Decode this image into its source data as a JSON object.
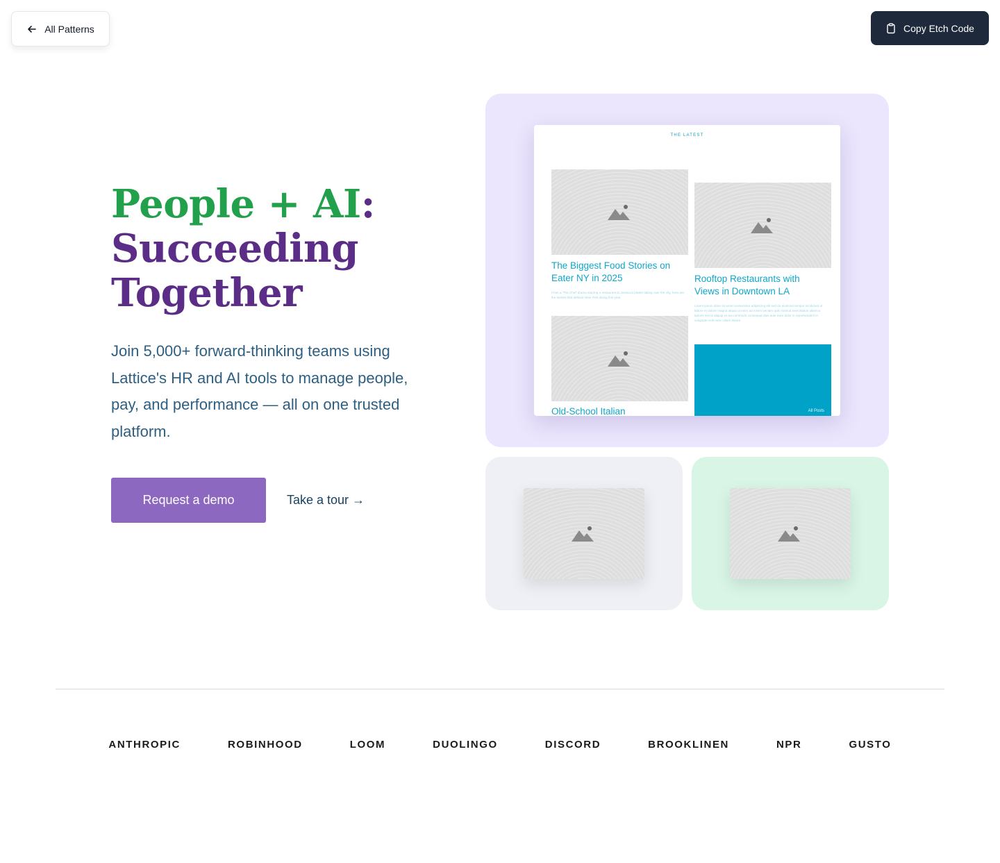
{
  "toolbar": {
    "back_label": "All Patterns",
    "copy_label": "Copy Etch Code"
  },
  "hero": {
    "headline_part1": "People + AI",
    "headline_colon": ":",
    "headline_line2": "Succeeding",
    "headline_line3": "Together",
    "subtext": "Join 5,000+ forward-thinking teams using Lattice's HR and AI tools to manage people, pay, and performance — all on one trusted platform.",
    "primary_cta": "Request a demo",
    "secondary_cta": "Take a tour →"
  },
  "preview": {
    "eyebrow": "THE LATEST",
    "posts": [
      {
        "title": "The Biggest Food Stories on Eater NY in 2025",
        "excerpt": "From a 'The Chef' drama starring a restaurant to Jessica's platter taking over the city, here are the stories that defined New York dining this year."
      },
      {
        "title": "Rooftop Restaurants with Views in Downtown LA",
        "excerpt": "Lorem ipsum dolor sit amet consectetur adipiscing elit sed do eiusmod tempor incididunt ut labore et dolore magna aliqua ut enim ad minim veniam quis nostrud exercitation ullamco laboris nisi ut aliquip ex ea commodo consequat duis aute irure dolor in reprehenderit in voluptate velit esse cillum dolore."
      },
      {
        "title": "Old-School Italian",
        "excerpt": ""
      }
    ],
    "all_posts": "All Posts"
  },
  "logos": [
    "ANTHROPIC",
    "ROBINHOOD",
    "LOOM",
    "DUOLINGO",
    "DISCORD",
    "BROOKLINEN",
    "NPR",
    "GUSTO"
  ],
  "colors": {
    "headline_green": "#22a04b",
    "headline_purple": "#5b2d86",
    "cta_purple": "#8d68c0",
    "preview_accent": "#00a3c7",
    "card_lavender": "#ebe5fd",
    "card_gray": "#eef0f5",
    "card_mint": "#d8f5e6"
  }
}
